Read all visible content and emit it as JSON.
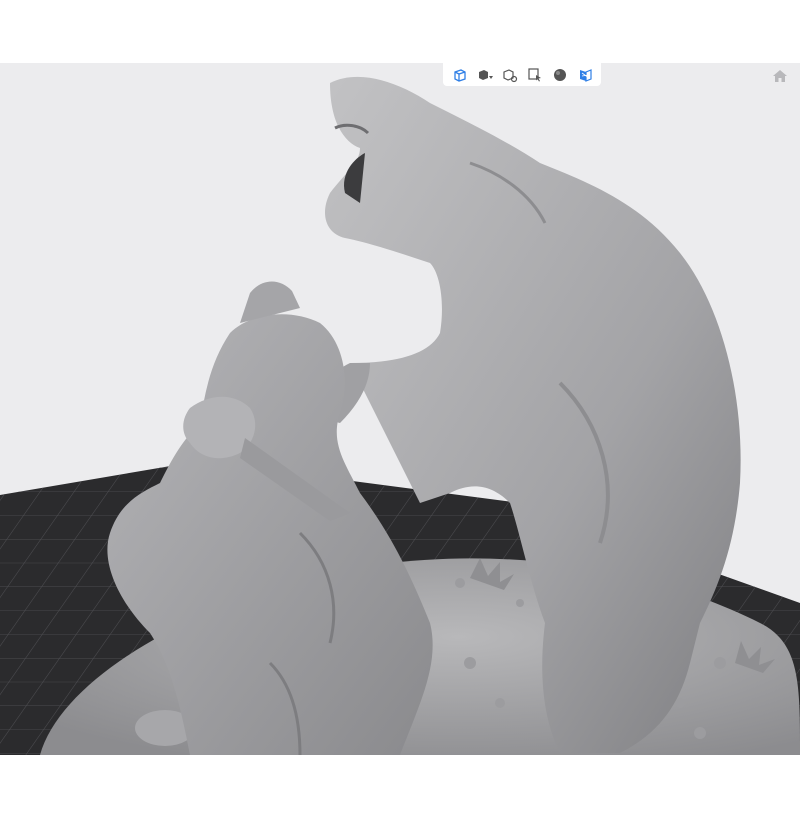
{
  "viewer": {
    "background": "#ececee",
    "bed_color": "#2b2b2d",
    "model_color": "#a9a9ab",
    "accent": "#2f7fe6"
  },
  "toolbar": {
    "items": [
      {
        "name": "view-cube-icon",
        "active": true
      },
      {
        "name": "view-preset-dropdown-icon",
        "active": false
      },
      {
        "name": "explode-view-icon",
        "active": false
      },
      {
        "name": "select-mode-icon",
        "active": false
      },
      {
        "name": "material-sphere-icon",
        "active": false
      },
      {
        "name": "section-plane-icon",
        "active": true
      }
    ]
  },
  "home_button": {
    "icon": "home-icon"
  }
}
